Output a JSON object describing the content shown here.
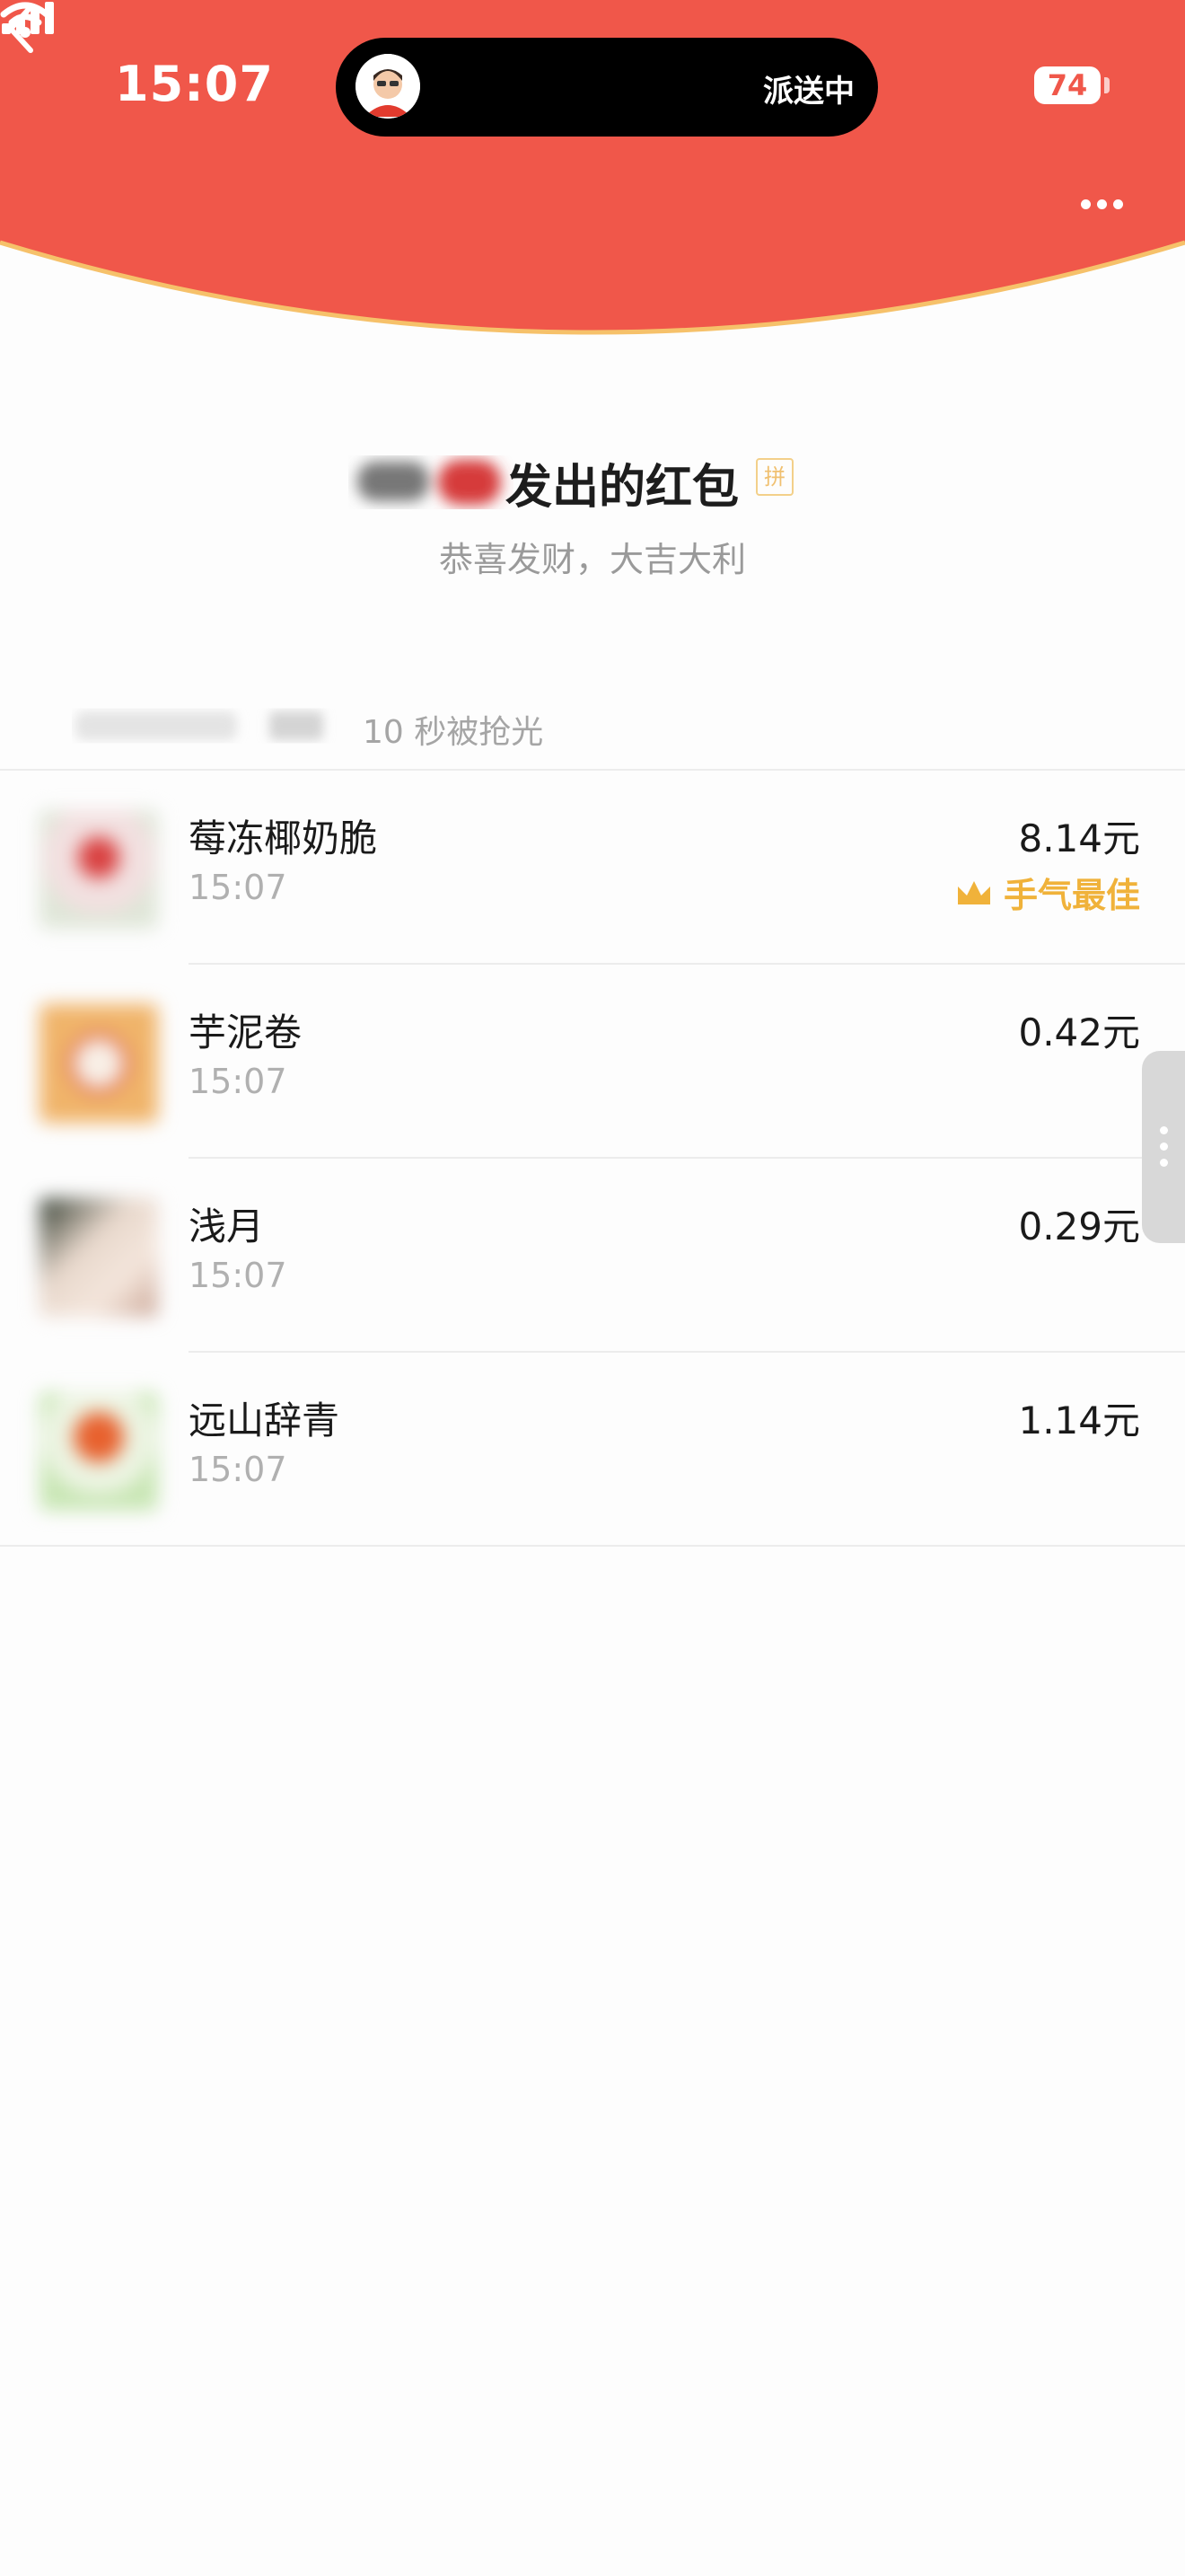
{
  "status_bar": {
    "time": "15:07",
    "live_activity_text": "派送中",
    "battery": "74"
  },
  "colors": {
    "header_red": "#f0574a",
    "header_edge": "#f6c16a",
    "best_gold": "#f0b23a"
  },
  "nav": {
    "back_icon": "chevron-left-icon",
    "more_icon": "more-dots-icon"
  },
  "envelope": {
    "title": "发出的红包",
    "tag": "拼",
    "greeting": "恭喜发财，大吉大利"
  },
  "summary": {
    "text": "10 秒被抢光"
  },
  "recipients": [
    {
      "name": "莓冻椰奶脆",
      "time": "15:07",
      "amount": "8.14元",
      "best": "手气最佳"
    },
    {
      "name": "芋泥卷",
      "time": "15:07",
      "amount": "0.42元",
      "best": ""
    },
    {
      "name": "浅月",
      "time": "15:07",
      "amount": "0.29元",
      "best": ""
    },
    {
      "name": "远山辞青",
      "time": "15:07",
      "amount": "1.14元",
      "best": ""
    }
  ]
}
